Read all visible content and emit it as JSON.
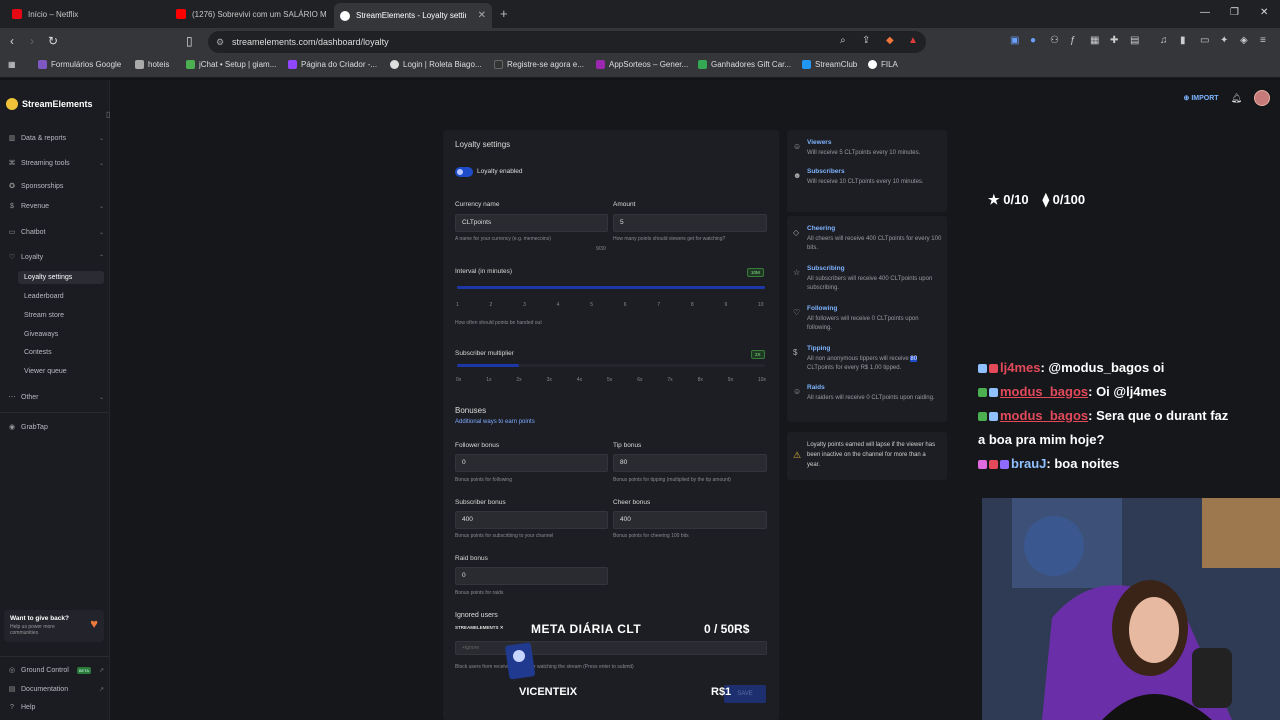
{
  "browser": {
    "tabs": [
      {
        "title": "Início – Netflix",
        "color": "#e50914"
      },
      {
        "title": "(1276) Sobrevivi com um SALÁRIO M",
        "color": "#ff0000"
      },
      {
        "title": "StreamElements - Loyalty setting",
        "color": "#ffffff"
      }
    ],
    "new_tab": "+",
    "url": "streamelements.com/dashboard/loyalty",
    "bookmarks": [
      {
        "label": "Formulários Google",
        "color": "#7e57c2"
      },
      {
        "label": "hoteis",
        "color": "#aaaaaa"
      },
      {
        "label": "jChat • Setup | giam...",
        "color": "#4caf50"
      },
      {
        "label": "Página do Criador -...",
        "color": "#9146ff"
      },
      {
        "label": "Login | Roleta Biago...",
        "color": "#dddddd"
      },
      {
        "label": "Registre-se agora e...",
        "color": "#333333"
      },
      {
        "label": "AppSorteos – Gener...",
        "color": "#9c27b0"
      },
      {
        "label": "Ganhadores Gift Car...",
        "color": "#34a853"
      },
      {
        "label": "StreamClub",
        "color": "#2196f3"
      },
      {
        "label": "FILA",
        "color": "#ffffff"
      }
    ]
  },
  "sidebar": {
    "brand": "StreamElements",
    "items": [
      {
        "label": "Data & reports",
        "chevron": true
      },
      {
        "label": "Streaming tools",
        "chevron": true
      },
      {
        "label": "Sponsorships",
        "chevron": false
      },
      {
        "label": "Revenue",
        "chevron": true
      },
      {
        "label": "Chatbot",
        "chevron": true
      },
      {
        "label": "Loyalty",
        "chevron": true
      }
    ],
    "loyalty_sub": [
      "Loyalty settings",
      "Leaderboard",
      "Stream store",
      "Giveaways",
      "Contests",
      "Viewer queue"
    ],
    "other": "Other",
    "grabtap": "GrabTap",
    "give_back_title": "Want to give back?",
    "give_back_sub": "Help us power more communities",
    "ground_control": "Ground Control",
    "beta": "BETA",
    "documentation": "Documentation",
    "help": "Help"
  },
  "header": {
    "import": "IMPORT"
  },
  "settings": {
    "title": "Loyalty settings",
    "toggle_label": "Loyalty enabled",
    "currency_label": "Currency name",
    "currency_value": "CLTpoints",
    "currency_hint": "A name for your currency (e.g. memecoins)",
    "currency_count": "9/30",
    "amount_label": "Amount",
    "amount_value": "5",
    "amount_hint": "How many points should viewers get for watching?",
    "interval_label": "Interval (in minutes)",
    "interval_tag": "10M",
    "interval_value": 10,
    "interval_ticks": [
      "1",
      "2",
      "3",
      "4",
      "5",
      "6",
      "7",
      "8",
      "9",
      "10"
    ],
    "interval_hint": "How often should points be handed out",
    "multiplier_label": "Subscriber multiplier",
    "multiplier_tag": "2X",
    "multiplier_value": 2,
    "multiplier_ticks": [
      "0x",
      "1x",
      "2x",
      "3x",
      "4x",
      "5x",
      "6x",
      "7x",
      "8x",
      "9x",
      "10x"
    ],
    "bonuses_title": "Bonuses",
    "bonuses_sub": "Additional ways to earn points",
    "follower_label": "Follower bonus",
    "follower_value": "0",
    "follower_hint": "Bonus points for following",
    "tip_label": "Tip bonus",
    "tip_value": "80",
    "tip_hint": "Bonus points for tipping (multiplied by the tip amount)",
    "subscriber_label": "Subscriber bonus",
    "subscriber_value": "400",
    "subscriber_hint": "Bonus points for subscribing to your channel",
    "cheer_label": "Cheer bonus",
    "cheer_value": "400",
    "cheer_hint": "Bonus points for cheering 100 bits",
    "raid_label": "Raid bonus",
    "raid_value": "0",
    "raid_hint": "Bonus points for raids",
    "ignored_title": "Ignored users",
    "ignored_chip": "STREAMELEMENTS",
    "ignored_placeholder": "+Ignore",
    "ignored_hint": "Block users from receiving points for watching the stream (Press enter to submit)",
    "save": "SAVE"
  },
  "info": [
    {
      "title": "Viewers",
      "desc": "Will receive 5 CLTpoints every 10 minutes.",
      "icon": "user-icon"
    },
    {
      "title": "Subscribers",
      "desc": "Will receive 10 CLTpoints every 10 minutes.",
      "icon": "user-star-icon"
    }
  ],
  "events": [
    {
      "title": "Cheering",
      "desc": "All cheers will receive 400 CLTpoints for every 100 bits.",
      "icon": "diamond-icon"
    },
    {
      "title": "Subscribing",
      "desc": "All subscribers will receive 400 CLTpoints upon subscribing.",
      "icon": "star-icon"
    },
    {
      "title": "Following",
      "desc": "All followers will receive 0 CLTpoints upon following.",
      "icon": "heart-icon"
    },
    {
      "title": "Tipping",
      "desc_pre": "All non anonymous tippers will receive ",
      "desc_hl": "80",
      "desc_post": " CLTpoints for every R$ 1,00 tipped.",
      "icon": "dollar-icon"
    },
    {
      "title": "Raids",
      "desc": "All raiders will receive 0 CLTpoints upon raiding.",
      "icon": "raid-icon"
    }
  ],
  "lapse": "Loyalty points earned will lapse if the viewer has been inactive on the channel for more than a year.",
  "overlay": {
    "stars": "★ 0/10",
    "drops": "⧫ 0/100",
    "chat": [
      {
        "user": "lj4mes",
        "msg": ": @modus_bagos oi",
        "blue": false
      },
      {
        "user": "modus_bagos",
        "msg": ": Oi @lj4mes",
        "blue": false
      },
      {
        "user": "modus_bagos",
        "msg": ": Sera que o durant faz",
        "blue": false
      },
      {
        "user": "",
        "msg": "a boa pra mim hoje?",
        "blue": false
      },
      {
        "user": "brauJ",
        "msg": ": boa noites",
        "blue": true
      }
    ],
    "meta_label": "META DIÁRIA CLT",
    "meta_value": "0 / 50R$",
    "vicenteix": "VICENTEIX",
    "rs": "R$1"
  }
}
